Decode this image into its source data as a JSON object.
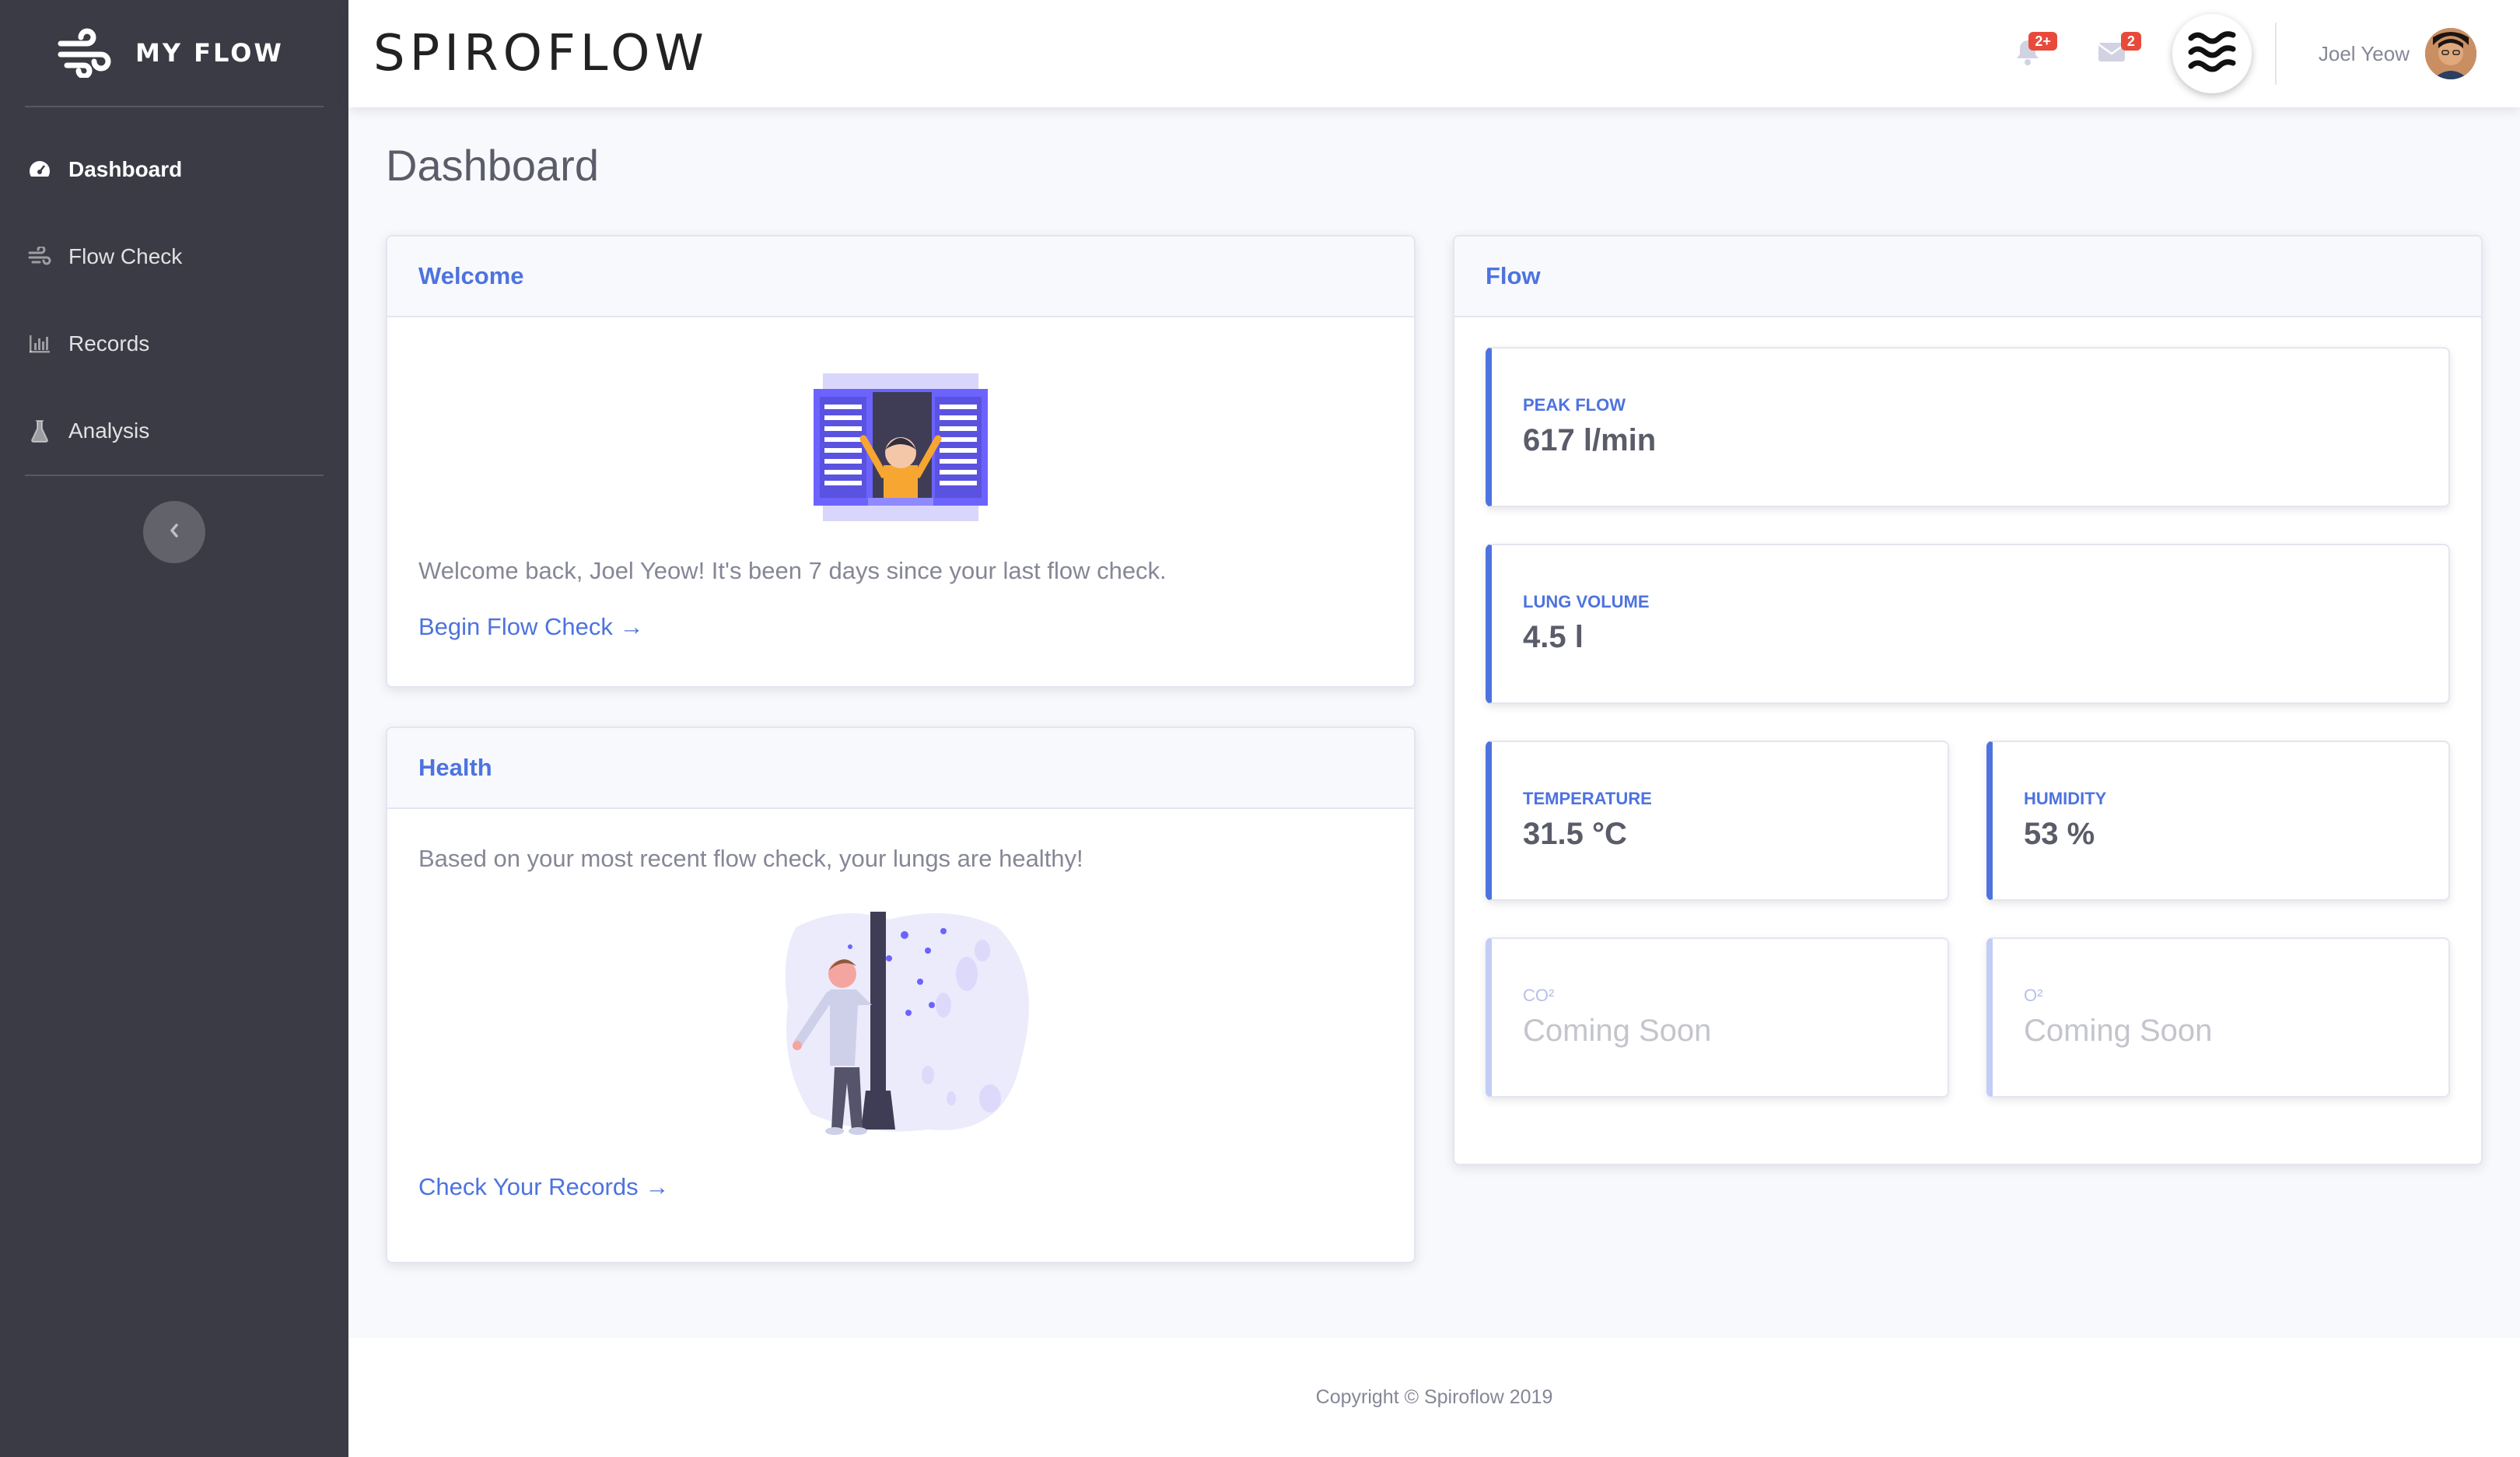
{
  "sidebar": {
    "brand": "MY FLOW",
    "items": [
      {
        "label": "Dashboard",
        "icon": "tachometer-icon",
        "active": true
      },
      {
        "label": "Flow Check",
        "icon": "wind-icon"
      },
      {
        "label": "Records",
        "icon": "bar-chart-icon"
      },
      {
        "label": "Analysis",
        "icon": "flask-icon"
      }
    ]
  },
  "topbar": {
    "title": "SPIROFLOW",
    "alerts_badge": "2+",
    "messages_badge": "2",
    "user_name": "Joel Yeow"
  },
  "page": {
    "title": "Dashboard"
  },
  "welcome": {
    "header": "Welcome",
    "message": "Welcome back, Joel Yeow! It's been 7 days since your last flow check.",
    "link": "Begin Flow Check →"
  },
  "health": {
    "header": "Health",
    "message": "Based on your most recent flow check, your lungs are healthy!",
    "link": "Check Your Records →"
  },
  "flow": {
    "header": "Flow",
    "peak_flow": {
      "label": "PEAK FLOW",
      "value": "617 l/min"
    },
    "lung_volume": {
      "label": "LUNG VOLUME",
      "value": "4.5 l"
    },
    "temperature": {
      "label": "TEMPERATURE",
      "value": "31.5 °C"
    },
    "humidity": {
      "label": "HUMIDITY",
      "value": "53 %"
    },
    "co2": {
      "label": "CO²",
      "value": "Coming Soon"
    },
    "o2": {
      "label": "O²",
      "value": "Coming Soon"
    }
  },
  "footer": {
    "copyright": "Copyright © Spiroflow 2019"
  },
  "colors": {
    "primary": "#4e73df",
    "sidebar": "#3a3b45",
    "danger": "#e74a3b"
  }
}
